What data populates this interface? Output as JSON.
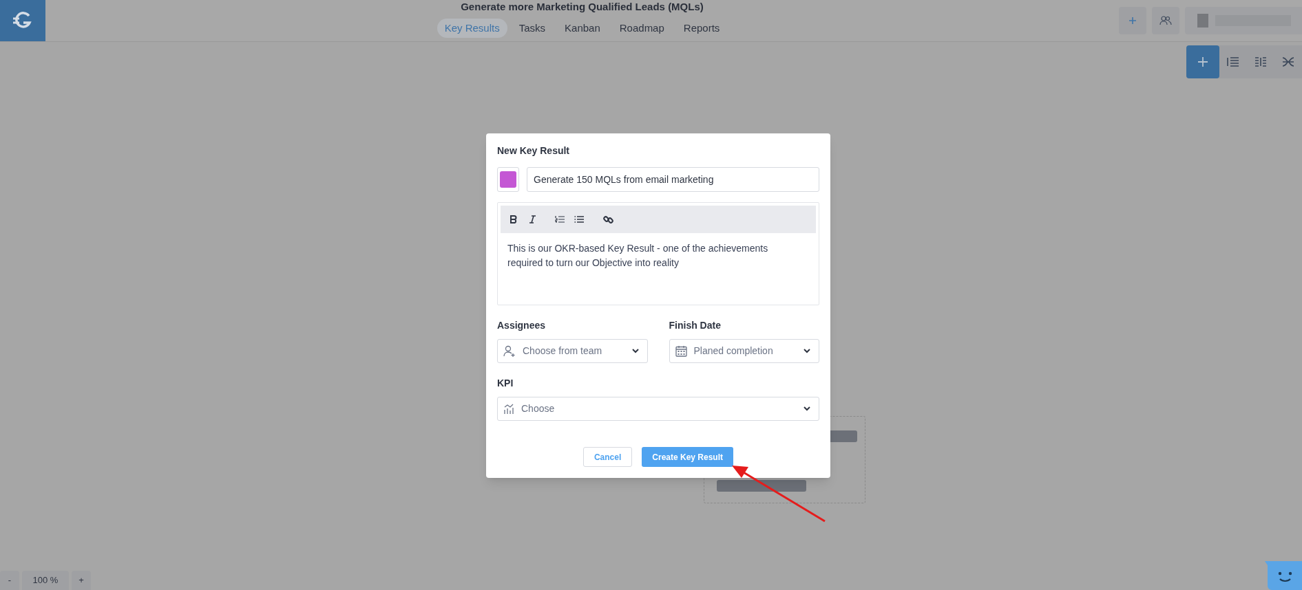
{
  "header": {
    "title": "Generate more Marketing Qualified Leads (MQLs)"
  },
  "tabs": [
    {
      "label": "Key Results",
      "selected": true
    },
    {
      "label": "Tasks",
      "selected": false
    },
    {
      "label": "Kanban",
      "selected": false
    },
    {
      "label": "Roadmap",
      "selected": false
    },
    {
      "label": "Reports",
      "selected": false
    }
  ],
  "zoom": {
    "minus": "-",
    "value": "100 %",
    "plus": "+"
  },
  "dialog": {
    "title": "New Key Result",
    "color": "#c457d4",
    "name_value": "Generate 150 MQLs from email marketing",
    "description": "This is our OKR-based Key Result - one of the achievements required to turn our Objective into reality",
    "fields": [
      {
        "label": "Assignees",
        "placeholder": "Choose from team",
        "kind": "person"
      },
      {
        "label": "Finish Date",
        "placeholder": "Planed completion",
        "kind": "date"
      },
      {
        "label": "KPI",
        "placeholder": "Choose",
        "kind": "chart"
      }
    ],
    "buttons": [
      {
        "label": "Cancel",
        "kind": "secondary"
      },
      {
        "label": "Create Key Result",
        "kind": "primary"
      }
    ]
  }
}
